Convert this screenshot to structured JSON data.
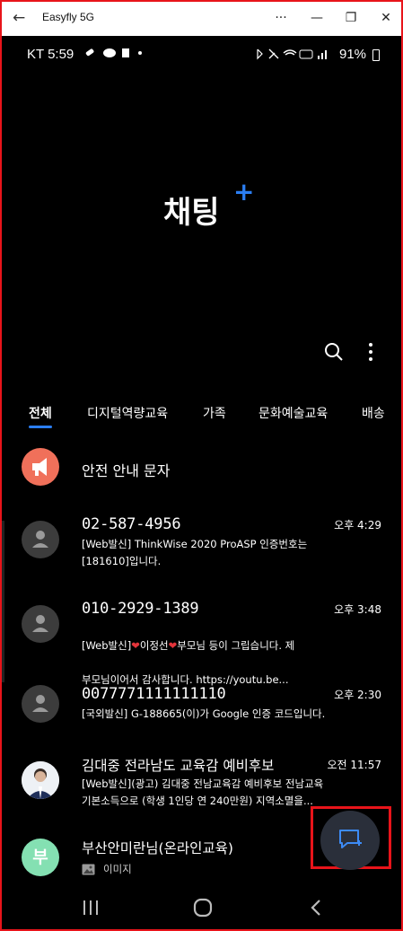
{
  "window": {
    "title": "Easyfly 5G",
    "back_glyph": "←",
    "more_glyph": "···",
    "minimize_glyph": "—",
    "restore_glyph": "❐",
    "close_glyph": "✕"
  },
  "statusbar": {
    "carrier": "KT",
    "time": "5:59",
    "battery": "91%"
  },
  "app": {
    "title": "채팅",
    "title_plus": "+"
  },
  "tabs": [
    {
      "label": "전체",
      "active": true
    },
    {
      "label": "디지털역량교육"
    },
    {
      "label": "가족"
    },
    {
      "label": "문화예술교육"
    },
    {
      "label": "배송"
    }
  ],
  "chats": [
    {
      "name": "안전 안내 문자",
      "time": "",
      "preview": "",
      "avatar": "megaphone-icon"
    },
    {
      "name": "02-587-4956",
      "time": "오후 4:29",
      "preview": "[Web발신] ThinkWise 2020 ProASP 인증번호는\n[181610]입니다.",
      "avatar": "person-icon"
    },
    {
      "name": "010-2929-1389",
      "time": "오후 3:48",
      "preview_parts": [
        "[Web발신]",
        "❤",
        "이정선",
        "❤",
        "부모님 등이 그립습니다. 제"
      ],
      "preview_line2": "부모님이어서 감사합니다. https://youtu.be...",
      "avatar": "person-icon"
    },
    {
      "name": "0077771111111110",
      "time": "오후 2:30",
      "preview": "[국외발신] G-188665(이)가 Google 인증 코드입니다.",
      "avatar": "person-icon"
    },
    {
      "name": "김대중 전라남도 교육감 예비후보",
      "time": "오전 11:57",
      "preview": "[Web발신](광고) 김대중   전남교육감 예비후보   전남교육\n기본소득으로 (학생 1인당 연 240만원) 지역소멸을...",
      "avatar": "photo"
    },
    {
      "name": "부산안미란님(온라인교육)",
      "time": "",
      "preview": "이미지",
      "avatar_letter": "부"
    }
  ],
  "colors": {
    "accent": "#2b7ef2",
    "highlight_border": "#e8141a",
    "megaphone_avatar": "#f0705a",
    "letter_avatar": "#84e0b2",
    "heart": "#e3343a"
  }
}
